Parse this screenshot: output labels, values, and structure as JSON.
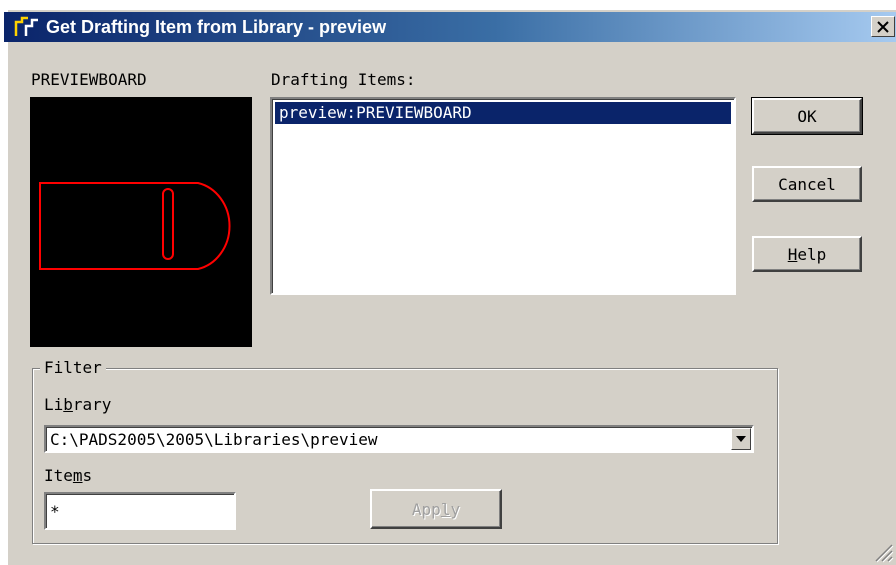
{
  "window": {
    "title": "Get Drafting Item from Library - preview",
    "close_glyph": "✕",
    "title_gradient": [
      "#0a246a",
      "#3a6ea5",
      "#a6caf0"
    ],
    "face_color": "#d4d0c8"
  },
  "preview": {
    "label": "PREVIEWBOARD",
    "background": "#000000",
    "stroke_color": "#ff0000"
  },
  "drafting_items": {
    "label": "Drafting Items:",
    "items": [
      "preview:PREVIEWBOARD"
    ],
    "selected_index": 0,
    "selection_color": "#0a246a"
  },
  "buttons": {
    "ok": "OK",
    "cancel": "Cancel",
    "help_pre": "",
    "help_mnemonic": "H",
    "help_post": "elp"
  },
  "filter": {
    "legend": "Filter",
    "library_label_pre": "Li",
    "library_label_mnemonic": "b",
    "library_label_post": "rary",
    "library_value": "C:\\PADS2005\\2005\\Libraries\\preview",
    "items_label_pre": "Ite",
    "items_label_mnemonic": "m",
    "items_label_post": "s",
    "items_value": "*",
    "apply_pre": "App",
    "apply_mnemonic": "l",
    "apply_post": "y"
  },
  "icons": {
    "app": "app-icon",
    "close": "close-icon",
    "dropdown": "chevron-down-icon",
    "grip": "resize-grip-icon"
  }
}
